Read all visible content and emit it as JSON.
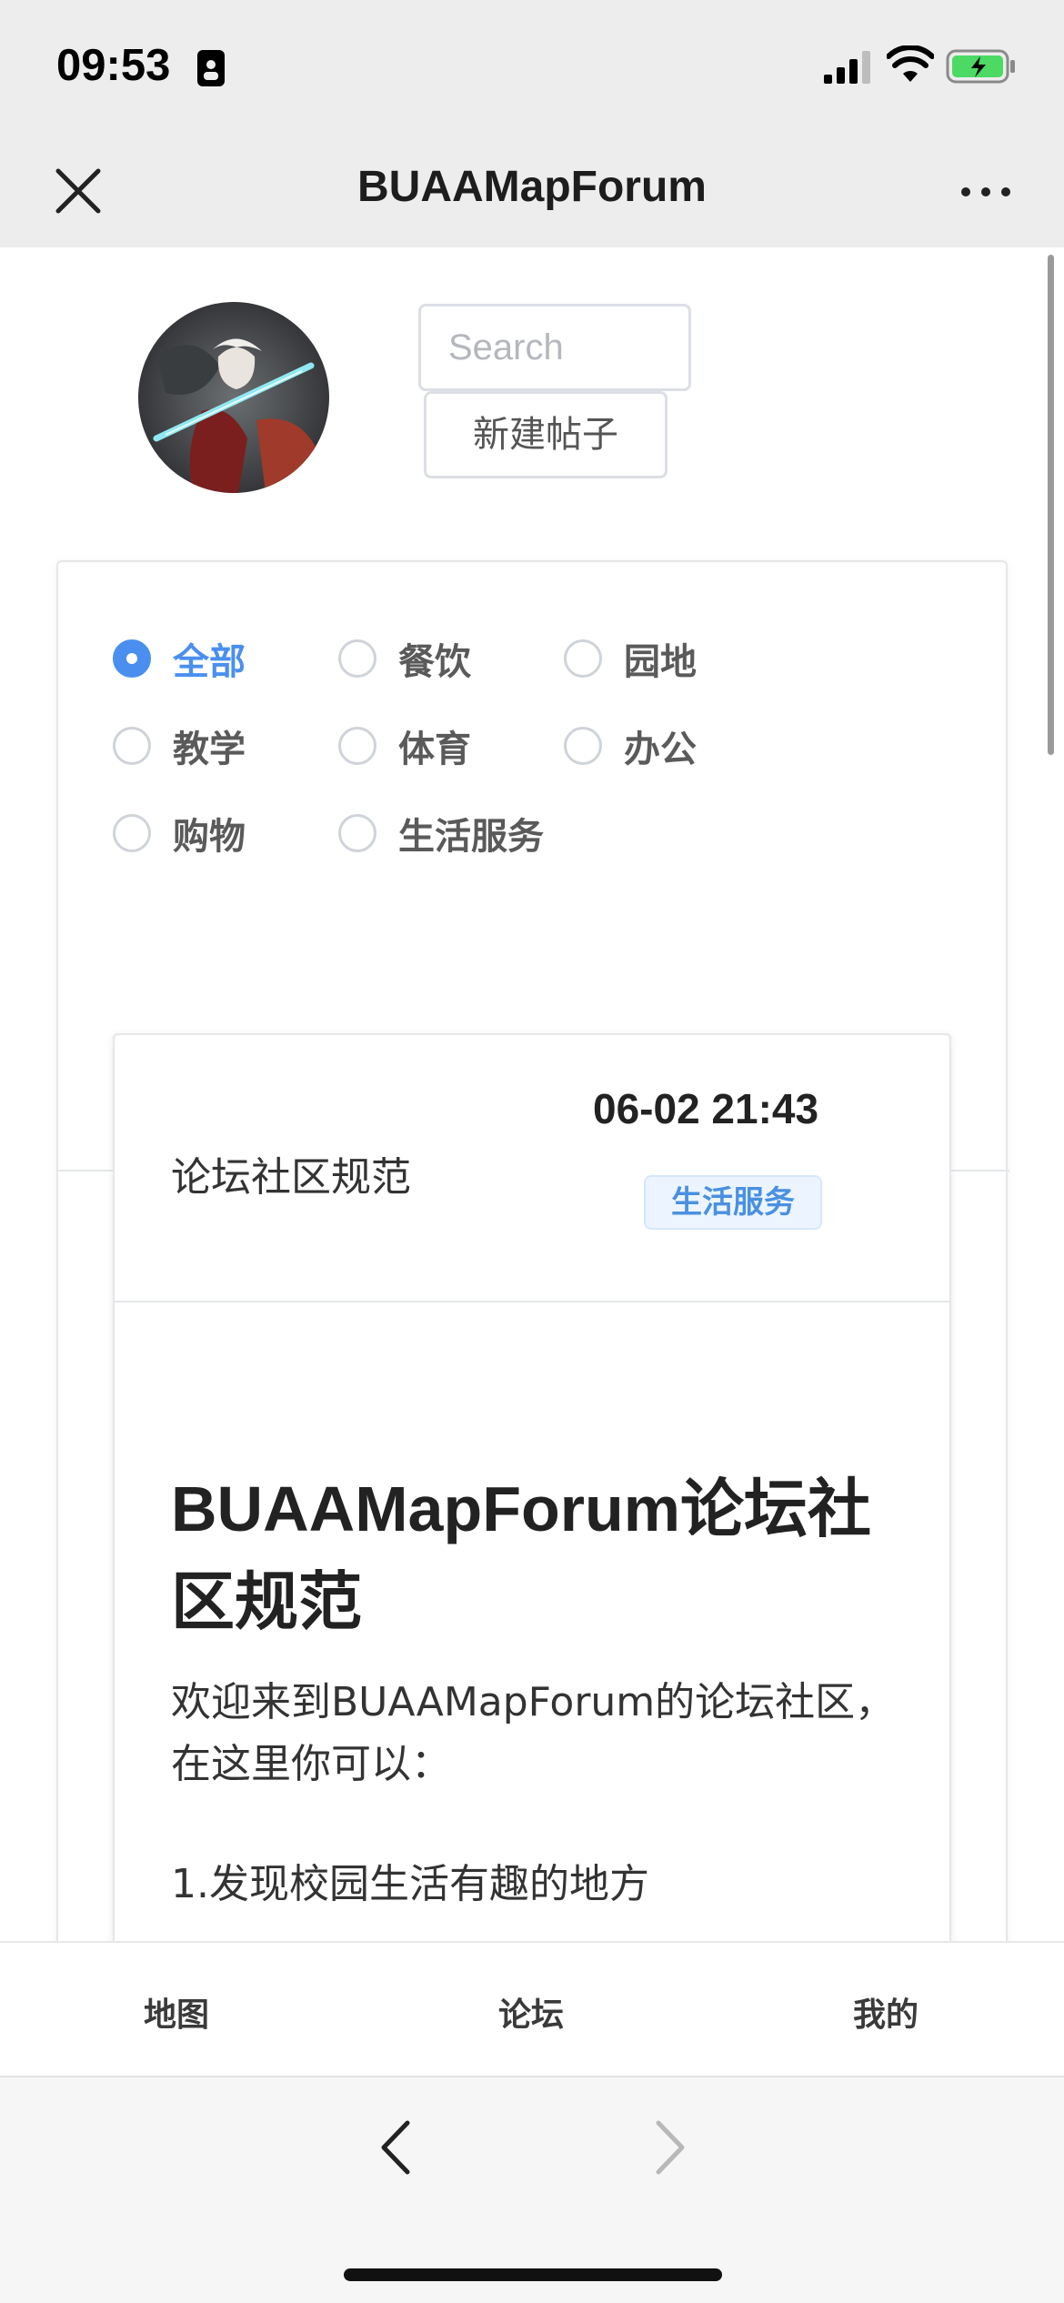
{
  "status_bar": {
    "time": "09:53"
  },
  "nav": {
    "title": "BUAAMapForum"
  },
  "search": {
    "placeholder": "Search"
  },
  "new_post_label": "新建帖子",
  "filters": [
    {
      "label": "全部",
      "checked": true
    },
    {
      "label": "餐饮",
      "checked": false
    },
    {
      "label": "园地",
      "checked": false
    },
    {
      "label": "教学",
      "checked": false
    },
    {
      "label": "体育",
      "checked": false
    },
    {
      "label": "办公",
      "checked": false
    },
    {
      "label": "购物",
      "checked": false
    },
    {
      "label": "生活服务",
      "checked": false
    }
  ],
  "post": {
    "title": "论坛社区规范",
    "time": "06-02 21:43",
    "tag": "生活服务",
    "heading": "BUAAMapForum论坛社区规范",
    "paragraph": "欢迎来到BUAAMapForum的论坛社区，在这里你可以：",
    "item1": "1.发现校园生活有趣的地方"
  },
  "tabs": [
    "地图",
    "论坛",
    "我的"
  ],
  "colors": {
    "accent": "#4a8ff0",
    "tag_bg": "#ecf5ff",
    "tag_text": "#4a90e2"
  },
  "icons": [
    "close-icon",
    "more-icon",
    "signal-icon",
    "wifi-icon",
    "battery-icon",
    "back-arrow-icon",
    "forward-arrow-icon"
  ]
}
